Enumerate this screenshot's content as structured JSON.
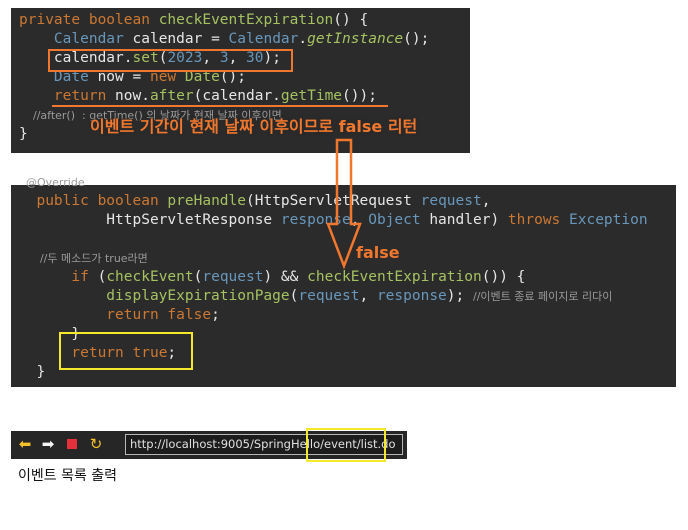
{
  "panel1": {
    "lines": [
      {
        "segments": [
          {
            "t": "private ",
            "c": "kw"
          },
          {
            "t": "boolean ",
            "c": "kw"
          },
          {
            "t": "checkEventExpiration",
            "c": "fn"
          },
          {
            "t": "() {",
            "c": "pl"
          }
        ]
      },
      {
        "segments": [
          {
            "t": "    Calendar ",
            "c": "ty"
          },
          {
            "t": "calendar ",
            "c": "pl"
          },
          {
            "t": "= ",
            "c": "pl"
          },
          {
            "t": "Calendar",
            "c": "ty"
          },
          {
            "t": ".",
            "c": "pl"
          },
          {
            "t": "getInstance",
            "c": "it"
          },
          {
            "t": "();",
            "c": "pl"
          }
        ]
      },
      {
        "segments": [
          {
            "t": "    calendar.",
            "c": "pl"
          },
          {
            "t": "set",
            "c": "fn"
          },
          {
            "t": "(",
            "c": "pl"
          },
          {
            "t": "2023",
            "c": "nm"
          },
          {
            "t": ", ",
            "c": "pl"
          },
          {
            "t": "3",
            "c": "nm"
          },
          {
            "t": ", ",
            "c": "pl"
          },
          {
            "t": "30",
            "c": "nm"
          },
          {
            "t": ");",
            "c": "pl"
          }
        ]
      },
      {
        "segments": [
          {
            "t": "    Date ",
            "c": "ty"
          },
          {
            "t": "now ",
            "c": "pl"
          },
          {
            "t": "= ",
            "c": "pl"
          },
          {
            "t": "new ",
            "c": "kw"
          },
          {
            "t": "Date",
            "c": "fn"
          },
          {
            "t": "();",
            "c": "pl"
          }
        ]
      },
      {
        "segments": [
          {
            "t": "    return ",
            "c": "kw"
          },
          {
            "t": "now.",
            "c": "pl"
          },
          {
            "t": "after",
            "c": "fn"
          },
          {
            "t": "(calendar.",
            "c": "pl"
          },
          {
            "t": "getTime",
            "c": "fn"
          },
          {
            "t": "());",
            "c": "pl"
          }
        ]
      },
      {
        "segments": [
          {
            "t": "    //after()  : ",
            "c": "cm"
          },
          {
            "t": "getTime() 의 날짜가 현재 날짜 이후이면",
            "c": "cm"
          }
        ]
      },
      {
        "segments": [
          {
            "t": "}",
            "c": "pl"
          }
        ]
      }
    ]
  },
  "panel2": {
    "lines": [
      {
        "segments": [
          {
            "t": "  @Override",
            "c": "cm"
          }
        ]
      },
      {
        "segments": [
          {
            "t": "  public ",
            "c": "kw"
          },
          {
            "t": "boolean ",
            "c": "kw"
          },
          {
            "t": "preHandle",
            "c": "fn"
          },
          {
            "t": "(",
            "c": "pl"
          },
          {
            "t": "HttpServletRequest ",
            "c": "pl"
          },
          {
            "t": "request",
            "c": "ty"
          },
          {
            "t": ",",
            "c": "pl"
          }
        ]
      },
      {
        "segments": [
          {
            "t": "          HttpServletResponse ",
            "c": "pl"
          },
          {
            "t": "response",
            "c": "ty"
          },
          {
            "t": ", ",
            "c": "pl"
          },
          {
            "t": "Object ",
            "c": "ty"
          },
          {
            "t": "handler",
            "c": "pl"
          },
          {
            "t": ") ",
            "c": "pl"
          },
          {
            "t": "throws ",
            "c": "kw"
          },
          {
            "t": "Exception",
            "c": "ty"
          }
        ]
      },
      {
        "segments": [
          {
            "t": "",
            "c": "pl"
          }
        ]
      },
      {
        "segments": [
          {
            "t": "      //두 메소드가 true라면",
            "c": "cm"
          }
        ]
      },
      {
        "segments": [
          {
            "t": "      if ",
            "c": "kw"
          },
          {
            "t": "(",
            "c": "pl"
          },
          {
            "t": "checkEvent",
            "c": "fn"
          },
          {
            "t": "(",
            "c": "pl"
          },
          {
            "t": "request",
            "c": "ty"
          },
          {
            "t": ") && ",
            "c": "pl"
          },
          {
            "t": "checkEventExpiration",
            "c": "fn"
          },
          {
            "t": "()) {",
            "c": "pl"
          }
        ]
      },
      {
        "segments": [
          {
            "t": "          displayExpirationPage",
            "c": "fn"
          },
          {
            "t": "(",
            "c": "pl"
          },
          {
            "t": "request",
            "c": "ty"
          },
          {
            "t": ", ",
            "c": "pl"
          },
          {
            "t": "response",
            "c": "ty"
          },
          {
            "t": "); ",
            "c": "pl"
          },
          {
            "t": "//이벤트 종료 페이지로 리다이",
            "c": "cm"
          }
        ]
      },
      {
        "segments": [
          {
            "t": "          return ",
            "c": "kw"
          },
          {
            "t": "false",
            "c": "kw"
          },
          {
            "t": ";",
            "c": "pl"
          }
        ]
      },
      {
        "segments": [
          {
            "t": "      }",
            "c": "pl"
          }
        ]
      },
      {
        "segments": [
          {
            "t": "      return ",
            "c": "kw"
          },
          {
            "t": "true",
            "c": "kw"
          },
          {
            "t": ";",
            "c": "pl"
          }
        ]
      },
      {
        "segments": [
          {
            "t": "  }",
            "c": "pl"
          }
        ]
      }
    ]
  },
  "annotations": {
    "main_text": "이벤트 기간이 현재 날짜 이후이므로 false 리턴",
    "false_label": "false"
  },
  "browser": {
    "url": "http://localhost:9005/SpringHello/event/list.do",
    "back_icon": "back-arrow-icon",
    "forward_icon": "forward-arrow-icon",
    "stop_icon": "stop-icon",
    "refresh_icon": "refresh-icon"
  },
  "caption": "이벤트 목록 출력",
  "colors": {
    "code_bg": "#2b2b2b",
    "keyword": "#cc7832",
    "function": "#a5c261",
    "type": "#6897bb",
    "highlight_orange": "#f0772d",
    "highlight_yellow": "#f5e72a"
  }
}
